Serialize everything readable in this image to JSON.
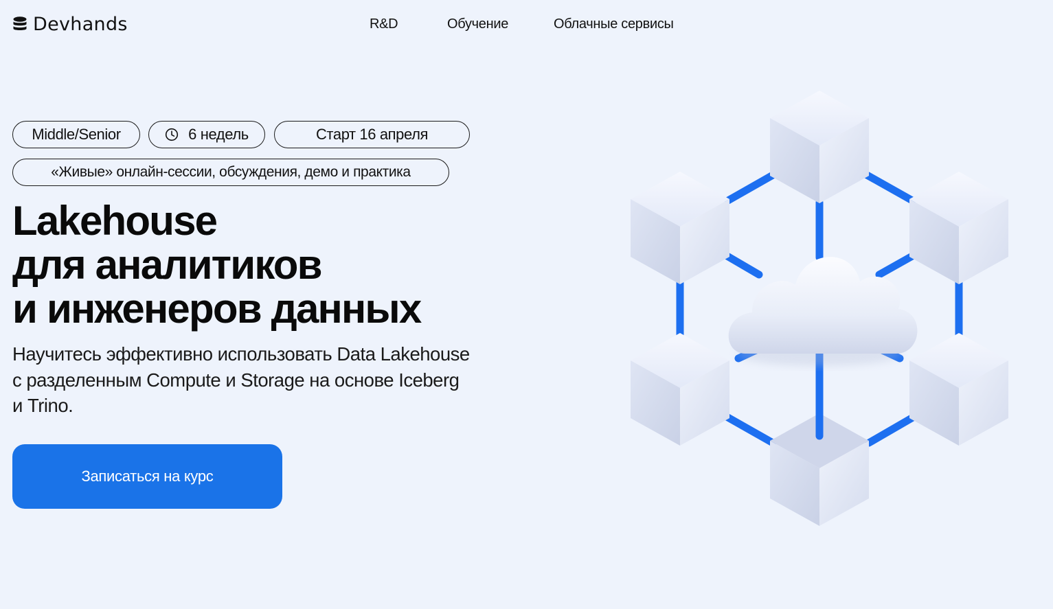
{
  "header": {
    "logo_text": "Devhands",
    "nav": [
      {
        "label": "R&D"
      },
      {
        "label": "Обучение"
      },
      {
        "label": "Облачные сервисы"
      }
    ]
  },
  "hero": {
    "tags": {
      "level": "Middle/Senior",
      "duration": "6 недель",
      "start": "Старт 16 апреля",
      "format": "«Живые» онлайн-сессии, обсуждения, демо и практика"
    },
    "title_lines": [
      "Lakehouse",
      "для аналитиков",
      "и инженеров данных"
    ],
    "subtitle_lines": [
      "Научитесь эффективно использовать Data Lakehouse",
      "с разделенным Compute и Storage на основе Iceberg",
      "и Trino."
    ],
    "cta_label": "Записаться на курс"
  },
  "icons": {
    "logo": "database-stack-icon",
    "duration": "clock-icon",
    "illustration": "cloud-network-cubes"
  },
  "colors": {
    "background": "#eef3fc",
    "accent": "#1a73e8",
    "text": "#0e0e0e"
  }
}
